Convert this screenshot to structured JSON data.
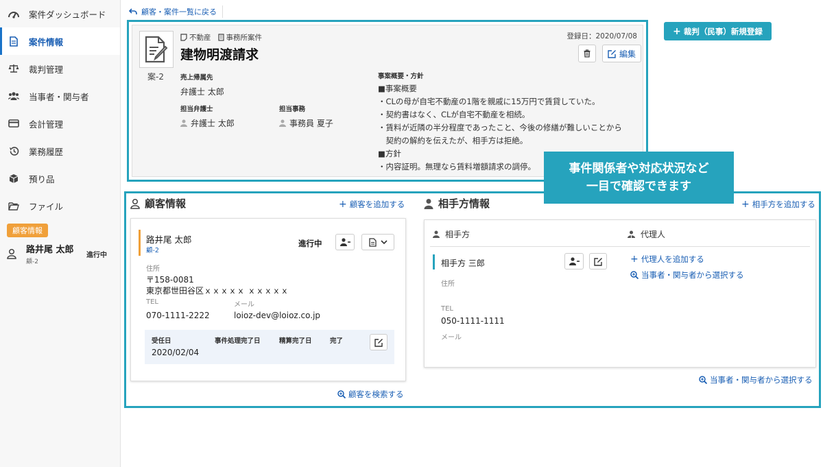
{
  "sidebar": {
    "items": [
      {
        "label": "案件ダッシュボード",
        "icon": "dashboard-icon"
      },
      {
        "label": "案件情報",
        "icon": "document-icon",
        "active": true
      },
      {
        "label": "裁判管理",
        "icon": "scales-icon"
      },
      {
        "label": "当事者・関与者",
        "icon": "users-icon"
      },
      {
        "label": "会計管理",
        "icon": "card-icon"
      },
      {
        "label": "業務履歴",
        "icon": "history-icon"
      },
      {
        "label": "預り品",
        "icon": "box-icon"
      },
      {
        "label": "ファイル",
        "icon": "folder-icon"
      }
    ],
    "client_badge": "顧客情報",
    "client": {
      "name": "路井尾 太郎",
      "id": "顧-2",
      "status": "進行中"
    }
  },
  "back_link": "顧客・案件一覧に戻る",
  "case": {
    "tag1": "不動産",
    "tag2": "事務所案件",
    "title": "建物明渡請求",
    "number": "案-2",
    "registered": "登録日：2020/07/08",
    "edit_label": "編集",
    "sales_label": "売上帰属先",
    "sales_value": "弁護士 太郎",
    "lawyer_label": "担当弁護士",
    "lawyer_value": "弁護士 太郎",
    "staff_label": "担当事務",
    "staff_value": "事務員 夏子",
    "overview_label": "事案概要・方針",
    "overview_lines": [
      "■事案概要",
      "・CLの母が自宅不動産の1階を親戚に15万円で賃貸していた。",
      "・契約書はなく、CLが自宅不動産を相続。",
      "・賃料が近隣の半分程度であったこと、今後の修繕が難しいことから",
      "　契約の解約を伝えたが、相手方は拒絶。",
      "■方針",
      "・内容証明。無理なら賃料増額請求の調停。"
    ]
  },
  "register_button": "裁判（民事）新規登録",
  "callout": {
    "line1": "事件関係者や対応状況など",
    "line2": "一目で確認できます"
  },
  "client_section": {
    "title": "顧客情報",
    "add_link": "顧客を追加する",
    "search_link": "顧客を検索する",
    "name": "路井尾 太郎",
    "id": "顧-2",
    "status": "進行中",
    "address_label": "住所",
    "postal": "〒158-0081",
    "address": "東京都世田谷区ｘｘｘｘｘ ｘｘｘｘｘ",
    "tel_label": "TEL",
    "tel": "070-1111-2222",
    "mail_label": "メール",
    "mail": "loioz-dev@loioz.co.jp",
    "received_label": "受任日",
    "done_label": "事件処理完了日",
    "settle_label": "精算完了日",
    "complete_label": "完了",
    "received_date": "2020/02/04"
  },
  "opponent_section": {
    "title": "相手方情報",
    "add_link": "相手方を追加する",
    "select_link": "当事者・関与者から選択する",
    "col1": "相手方",
    "col2": "代理人",
    "name": "相手方 三郎",
    "address_label": "住所",
    "tel_label": "TEL",
    "tel": "050-1111-1111",
    "mail_label": "メール",
    "add_agent": "代理人を追加する",
    "select_agent": "当事者・関与者から選択する"
  }
}
